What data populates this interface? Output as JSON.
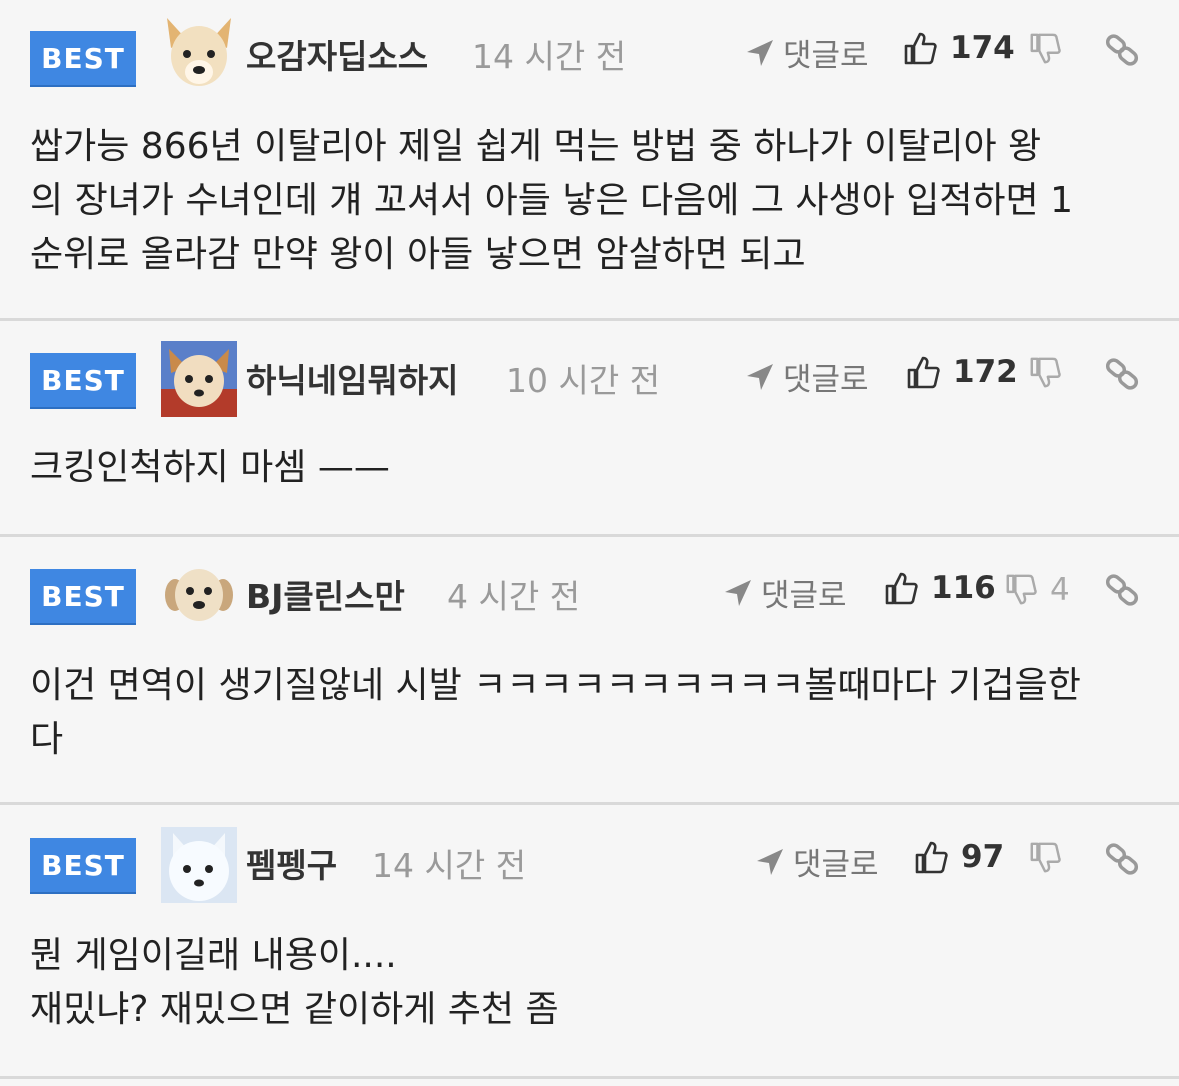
{
  "comments": [
    {
      "badge": "BEST",
      "author": "오감자딥소스",
      "time": "14 시간 전",
      "reply_label": "댓글로",
      "likes": "174",
      "dislikes": "",
      "text": "쌉가능 866년 이탈리아 제일 쉽게 먹는 방법 중 하나가 이탈리아 왕\n의 장녀가 수녀인데 걔 꼬셔서 아들 낳은 다음에 그 사생아 입적하면 1\n순위로 올라감 만약 왕이 아들 낳으면 암살하면 되고"
    },
    {
      "badge": "BEST",
      "author": "하닉네임뭐하지",
      "time": "10 시간 전",
      "reply_label": "댓글로",
      "likes": "172",
      "dislikes": "",
      "text": "크킹인척하지 마셈 ——"
    },
    {
      "badge": "BEST",
      "author": "BJ클린스만",
      "time": "4 시간 전",
      "reply_label": "댓글로",
      "likes": "116",
      "dislikes": "4",
      "text": "이건 면역이 생기질않네 시발 ㅋㅋㅋㅋㅋㅋㅋㅋㅋㅋ볼때마다 기겁을한\n다"
    },
    {
      "badge": "BEST",
      "author": "펨펭구",
      "time": "14 시간 전",
      "reply_label": "댓글로",
      "likes": "97",
      "dislikes": "",
      "text": "뭔 게임이길래 내용이....\n재밌냐? 재밌으면 같이하게 추천 좀"
    }
  ],
  "colors": {
    "badge": "#3f87e2",
    "background": "#f6f6f6",
    "separator": "#d9d9d9"
  },
  "icons": {
    "reply": "send-arrow-icon",
    "like": "thumbs-up-icon",
    "dislike": "thumbs-down-icon",
    "link": "link-icon"
  }
}
